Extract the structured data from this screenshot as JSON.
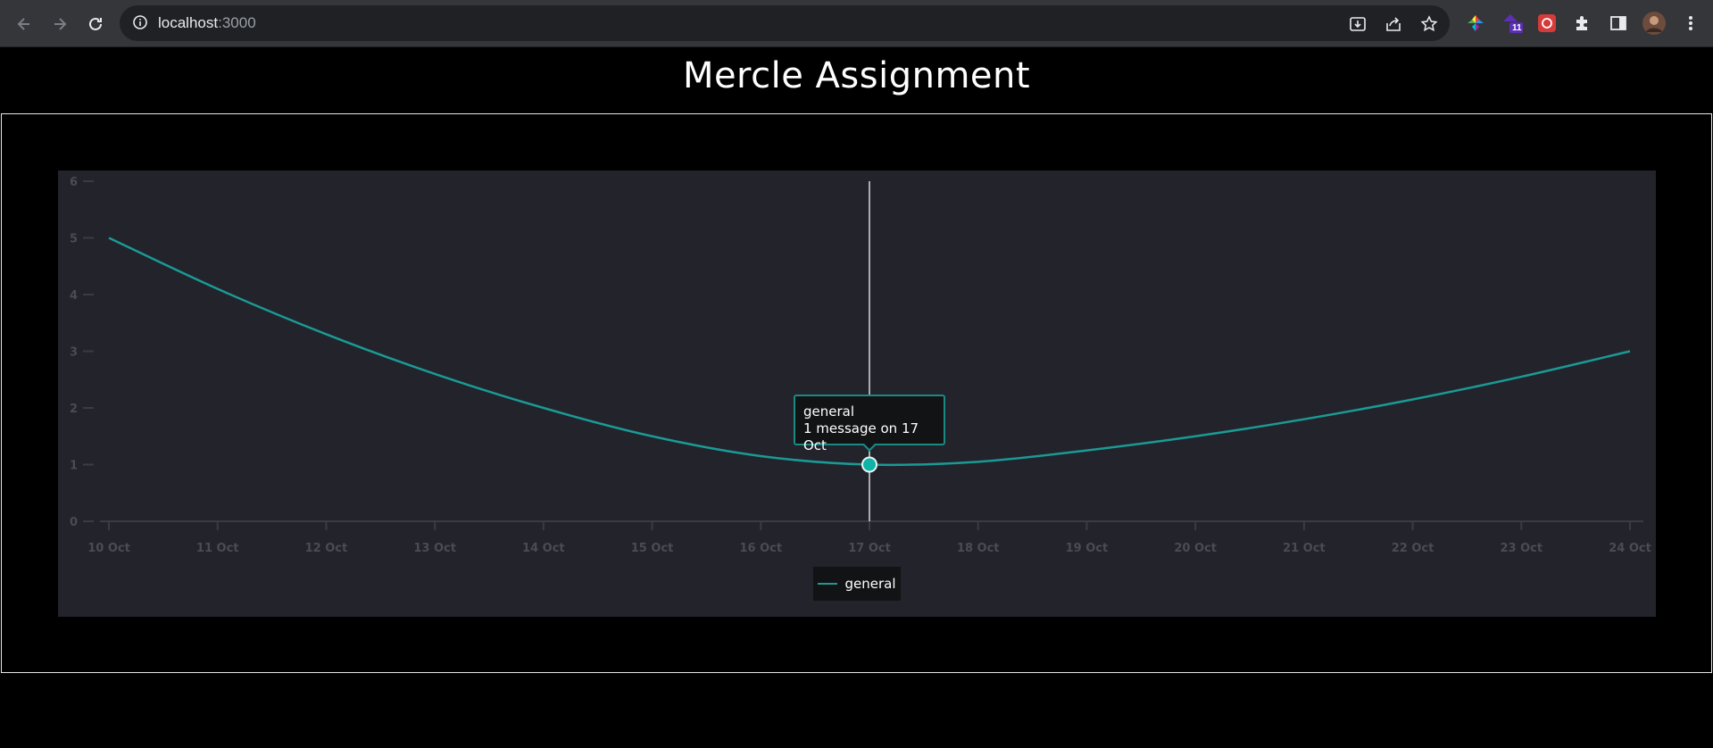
{
  "browser": {
    "url_host": "localhost",
    "url_port": ":3000",
    "extension_badge": "11"
  },
  "page": {
    "title": "Mercle Assignment"
  },
  "tooltip": {
    "series": "general",
    "text": "1 message on 17 Oct"
  },
  "legend": {
    "label": "general"
  },
  "colors": {
    "line": "#1b9a95",
    "panel": "#22232b",
    "background": "#000000"
  },
  "chart_data": {
    "type": "line",
    "x": [
      "10 Oct",
      "11 Oct",
      "12 Oct",
      "13 Oct",
      "14 Oct",
      "15 Oct",
      "16 Oct",
      "17 Oct",
      "18 Oct",
      "19 Oct",
      "20 Oct",
      "21 Oct",
      "22 Oct",
      "23 Oct",
      "24 Oct"
    ],
    "series": [
      {
        "name": "general",
        "values": [
          5,
          4.1,
          3.3,
          2.6,
          2.0,
          1.5,
          1.15,
          1.0,
          1.05,
          1.25,
          1.5,
          1.8,
          2.15,
          2.55,
          3.0
        ]
      }
    ],
    "yticks": [
      0,
      1,
      2,
      3,
      4,
      5,
      6
    ],
    "ylim": [
      0,
      6
    ],
    "highlight_index": 7,
    "grid": false,
    "legend_position": "bottom-center"
  }
}
